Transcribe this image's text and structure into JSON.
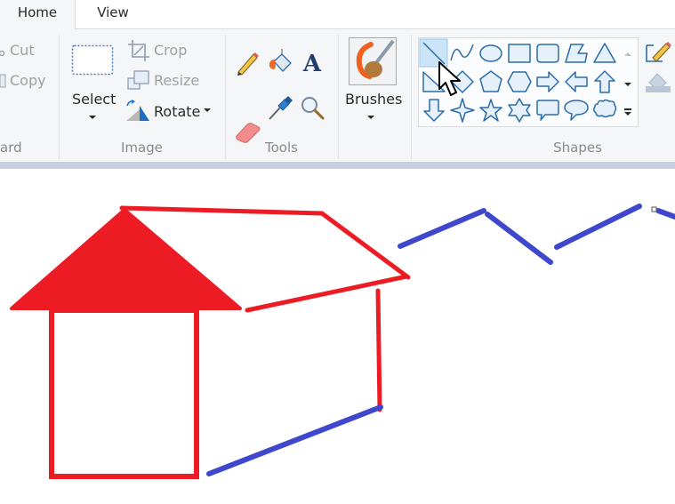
{
  "tabs": [
    {
      "label": "Home",
      "selected": true
    },
    {
      "label": "View",
      "selected": false
    }
  ],
  "ribbon": {
    "clipboard": {
      "label": "ard",
      "cut_label": "Cut",
      "copy_label": "Copy"
    },
    "image": {
      "label": "Image",
      "select_label": "Select",
      "crop_label": "Crop",
      "resize_label": "Resize",
      "rotate_label": "Rotate"
    },
    "tools": {
      "label": "Tools",
      "items": [
        "pencil",
        "fill-with-color",
        "text",
        "eraser",
        "color-picker",
        "magnifier"
      ]
    },
    "brushes": {
      "label": "Brushes"
    },
    "shapes": {
      "label": "Shapes",
      "selected": "line",
      "items": [
        "line",
        "curve",
        "oval",
        "rectangle",
        "rounded-rectangle",
        "polygon",
        "triangle",
        "right-triangle",
        "diamond",
        "pentagon",
        "hexagon",
        "right-arrow",
        "left-arrow",
        "up-arrow",
        "down-arrow",
        "four-point-star",
        "five-point-star",
        "six-point-star",
        "rounded-rectangular-callout",
        "oval-callout",
        "cloud-callout"
      ]
    }
  },
  "colors": {
    "red": "#ed1c24",
    "blue": "#3f48cc",
    "ribbon_bg": "#f5f6f7",
    "selected_cell": "#cce4f7"
  }
}
